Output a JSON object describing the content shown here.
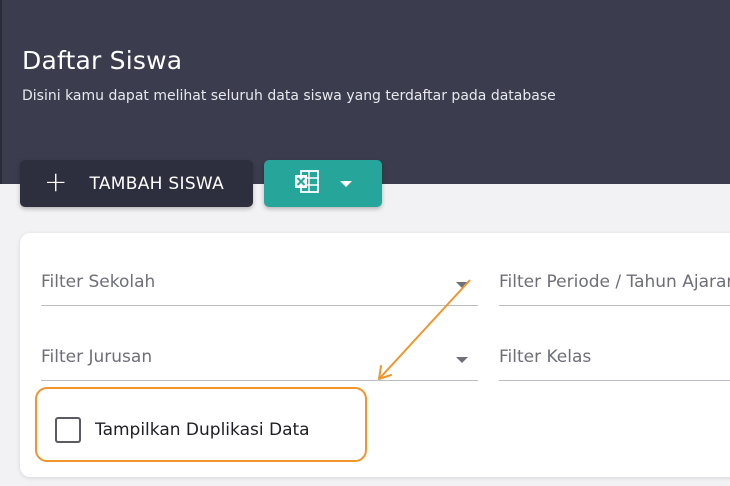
{
  "header": {
    "title": "Daftar Siswa",
    "subtitle": "Disini kamu dapat melihat seluruh data siswa yang terdaftar pada database"
  },
  "toolbar": {
    "add_button_label": "TAMBAH SISWA",
    "add_icon": "plus-icon",
    "excel_icon": "excel-icon",
    "excel_dropdown_icon": "caret-down-icon"
  },
  "filters": {
    "sekolah_placeholder": "Filter Sekolah",
    "periode_placeholder": "Filter Periode / Tahun Ajaran",
    "jurusan_placeholder": "Filter Jurusan",
    "kelas_placeholder": "Filter Kelas"
  },
  "options": {
    "show_duplicates_label": "Tampilkan Duplikasi Data",
    "show_duplicates_checked": false
  },
  "colors": {
    "header_bg": "#3b3c4d",
    "add_button_bg": "#2d2e3e",
    "excel_button_bg": "#26a69a",
    "annotation": "#f0942c"
  }
}
